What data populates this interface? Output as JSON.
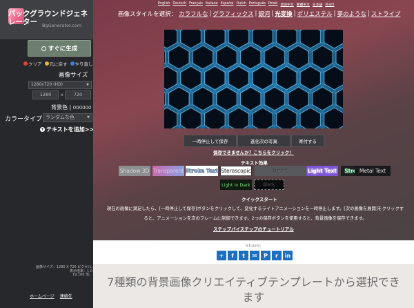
{
  "sidebar": {
    "logo": {
      "title": "バックグラウンドジェネレーター",
      "subtitle": "BgGenerator.com"
    },
    "generate_button": "すぐに生成",
    "history": {
      "clear": "クリア",
      "undo": "元に戻す",
      "redo": "やり直し"
    },
    "image_size": {
      "label": "画像サイズ",
      "selected": "1280x720 (HD)",
      "width_placeholder": "1280",
      "height_placeholder": "720",
      "separator": "x"
    },
    "bg_color": {
      "label": "背景色",
      "value": "000000"
    },
    "color_type": {
      "label": "カラータイプ",
      "selected": "ランダムな色"
    },
    "add_text": "テキストを追加>>",
    "size_info": {
      "line1": "画像サイズ：1280 X 720 ピクセル。",
      "line2": "表示倍率：1.0",
      "line3": "19.100 倍。"
    },
    "footer": {
      "home": "ホームページ",
      "contact": "連絡先"
    }
  },
  "languages": [
    "English",
    "Deutsch",
    "Français",
    "Italiano",
    "Español",
    "Dutch",
    "Português",
    "Polski",
    "简体中文",
    "繁體中文",
    "日本語",
    "한국어"
  ],
  "style_nav": {
    "label": "画像スタイルを選択：",
    "items": [
      {
        "label": "カラフルな",
        "active": false
      },
      {
        "label": "グラフィックス",
        "active": false
      },
      {
        "label": "銀河",
        "active": false
      },
      {
        "label": "光変換",
        "active": true
      },
      {
        "label": "ポリエステル",
        "active": false
      },
      {
        "label": "夢のような",
        "active": false
      },
      {
        "label": "ストライプ",
        "active": false
      }
    ]
  },
  "actions": {
    "save": "一時停止して保存",
    "next": "進化次の写真",
    "donate": "寄付する"
  },
  "cant_save_link": "保存できませんか？こちらをクリック！",
  "text_effects": {
    "label": "テキスト効果",
    "items": [
      "Shadow 3D",
      "Transparent",
      "Stroke Text",
      "Steroscopic",
      "Inset",
      "Light Text",
      "Stroke 3D",
      "Metal Text",
      "Light in Dark",
      "Blank"
    ]
  },
  "quickstart": {
    "label": "クイックスタート",
    "line1": "現在の画像に満足したら、[一時停止して保存]ボタンをクリックして、変化するライトアニメーションを一時停止します。[次の画像を展開]をクリックす",
    "line2": "ると、アニメーションを次のフレームに制御できます。2つの保存ボタンを使用すると、背景画像を保存できます。",
    "tutorial": "ステップバイステップのチュートリアル"
  },
  "share": {
    "label": "Share:",
    "icons": [
      "+",
      "f",
      "t",
      "✉",
      "P",
      "r",
      "in"
    ]
  },
  "bottom_heading": "7種類の背景画像クリエイティブテンプレートから選択できます",
  "colors": {
    "sidebar": "#27282b",
    "accent_share": "#1f6fc1",
    "glow": "#2aa7ff"
  }
}
